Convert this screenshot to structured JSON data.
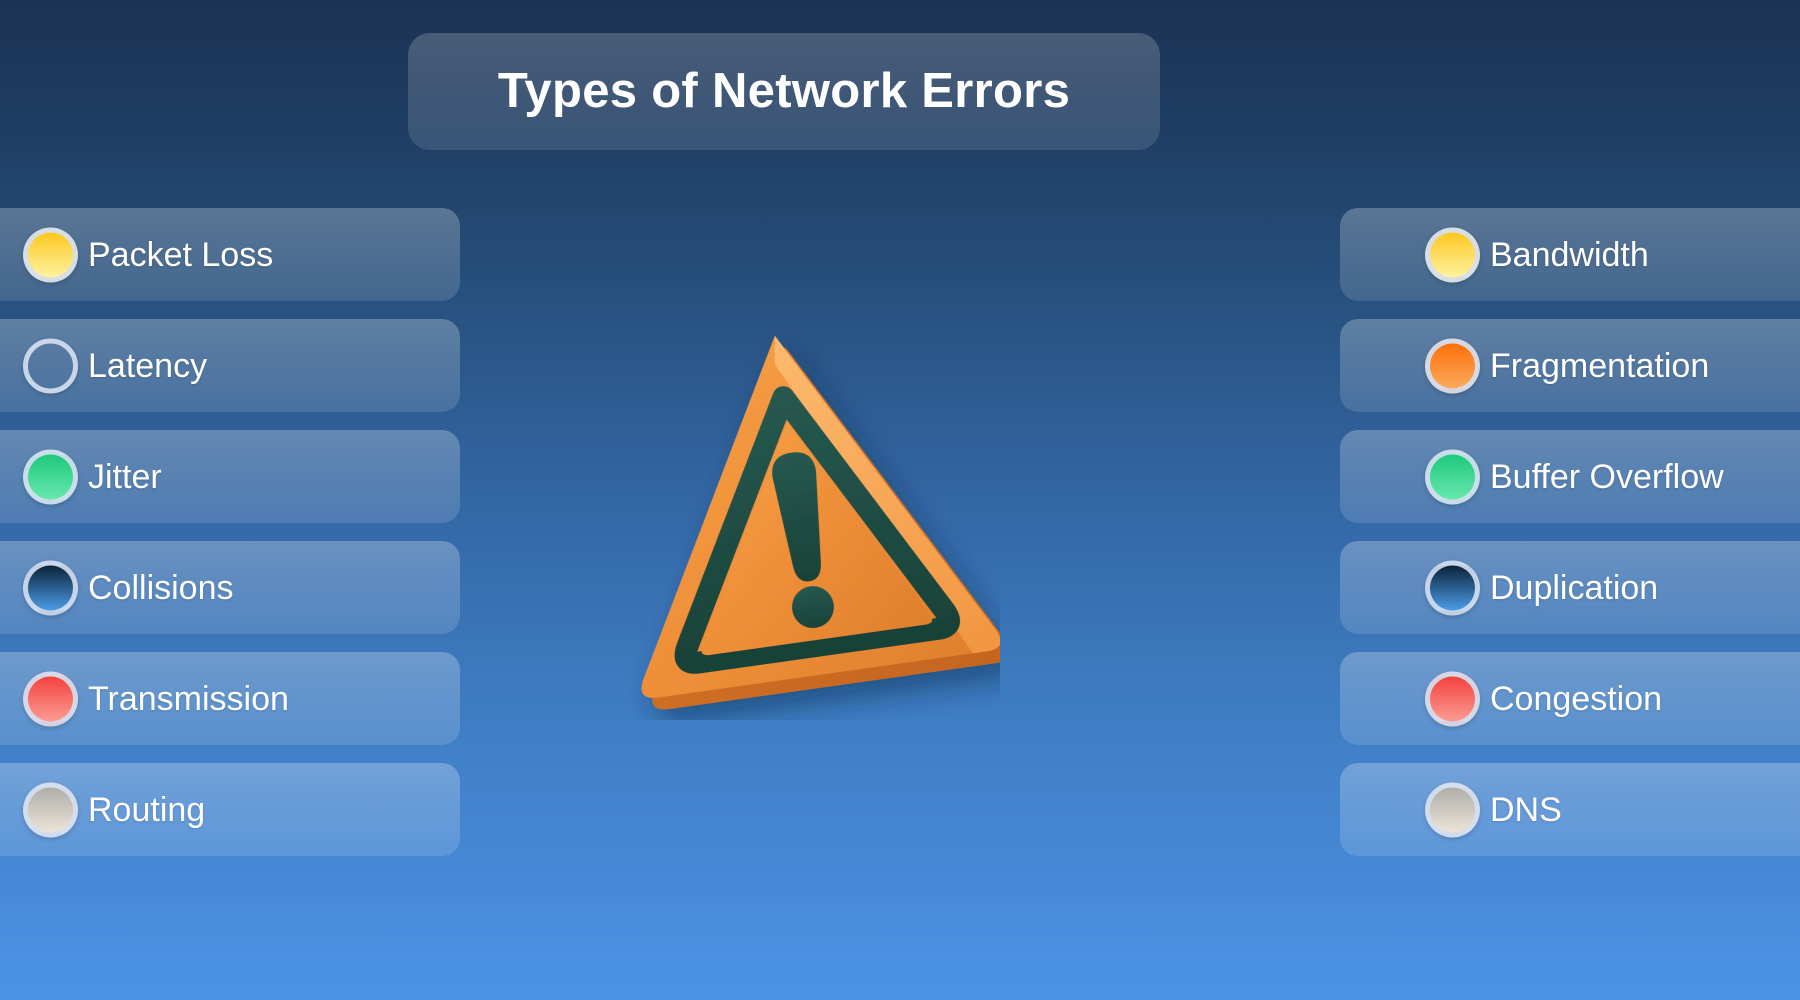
{
  "header": {
    "title": "Types of Network Errors"
  },
  "center": {
    "icon_name": "warning-triangle-icon",
    "icon_body_color": "#f0923c",
    "icon_mark_color": "#1f5047"
  },
  "theme": {
    "background_top": "#1c3454",
    "background_bottom": "#4b95e6",
    "card_text_color": "#ffffff",
    "dot_ring_color": "#d4def0"
  },
  "columns": {
    "left": {
      "items": [
        {
          "label": "Packet Loss",
          "color": "#ffd630",
          "color_name": "yellow",
          "color_top": "#fdc81f",
          "color_bottom": "#fdf2a0"
        },
        {
          "label": "Latency",
          "color": "#ff7a18",
          "color_name": "orange",
          "color_top": "#fd6f09",
          "color_bottom": "#fca濃"
        },
        {
          "label": "Jitter",
          "color": "#2fd18a",
          "color_name": "green",
          "color_top": "#1ec97d",
          "color_bottom": "#67e8ad"
        },
        {
          "label": "Collisions",
          "color": "#123a63",
          "color_name": "dark-blue",
          "color_top": "#0b2238",
          "color_bottom": "#4c9ce8"
        },
        {
          "label": "Transmission",
          "color": "#f5544f",
          "color_name": "red",
          "color_top": "#f4423e",
          "color_bottom": "#fb9c93"
        },
        {
          "label": "Routing",
          "color": "#b9b9b4",
          "color_name": "grey",
          "color_top": "#aeaeaa",
          "color_bottom": "#ece4d8"
        }
      ]
    },
    "right": {
      "items": [
        {
          "label": "Bandwidth",
          "color": "#ffd630",
          "color_name": "yellow",
          "color_top": "#fdc81f",
          "color_bottom": "#fdf2a0"
        },
        {
          "label": "Fragmentation",
          "color": "#ff7a18",
          "color_name": "orange",
          "color_top": "#fd6f09",
          "color_bottom": "#fcab5e"
        },
        {
          "label": "Buffer Overflow",
          "color": "#2fd18a",
          "color_name": "green",
          "color_top": "#1ec97d",
          "color_bottom": "#67e8ad"
        },
        {
          "label": "Duplication",
          "color": "#123a63",
          "color_name": "dark-blue",
          "color_top": "#0b2238",
          "color_bottom": "#4c9ce8"
        },
        {
          "label": "Congestion",
          "color": "#f5544f",
          "color_name": "red",
          "color_top": "#f4423e",
          "color_bottom": "#fb9c93"
        },
        {
          "label": "DNS",
          "color": "#b9b9b4",
          "color_name": "grey",
          "color_top": "#aeaeaa",
          "color_bottom": "#ece4d8"
        }
      ]
    }
  }
}
